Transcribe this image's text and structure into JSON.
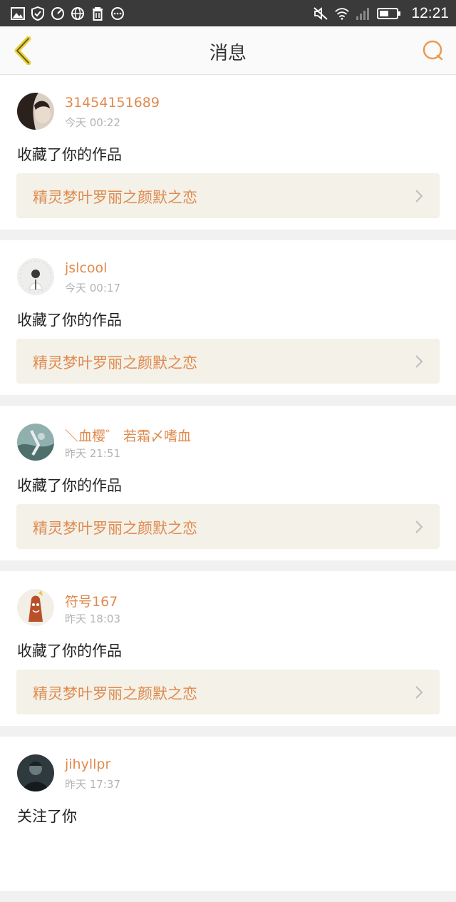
{
  "status": {
    "time": "12:21"
  },
  "header": {
    "title": "消息"
  },
  "messages": [
    {
      "username": "31454151689",
      "time": "今天 00:22",
      "action": "收藏了你的作品",
      "work": "精灵梦叶罗丽之颜默之恋"
    },
    {
      "username": "jslcool",
      "time": "今天 00:17",
      "action": "收藏了你的作品",
      "work": "精灵梦叶罗丽之颜默之恋"
    },
    {
      "username": "＼血樱゛ 若霜〆嗜血",
      "time": "昨天 21:51",
      "action": "收藏了你的作品",
      "work": "精灵梦叶罗丽之颜默之恋"
    },
    {
      "username": "符号167",
      "time": "昨天 18:03",
      "action": "收藏了你的作品",
      "work": "精灵梦叶罗丽之颜默之恋"
    },
    {
      "username": "jihyllpr",
      "time": "昨天 17:37",
      "action": "关注了你",
      "work": ""
    }
  ],
  "colors": {
    "accent": "#e08a4e",
    "statusbar": "#3a3a3a",
    "back_arrow": "#e6d23a"
  }
}
